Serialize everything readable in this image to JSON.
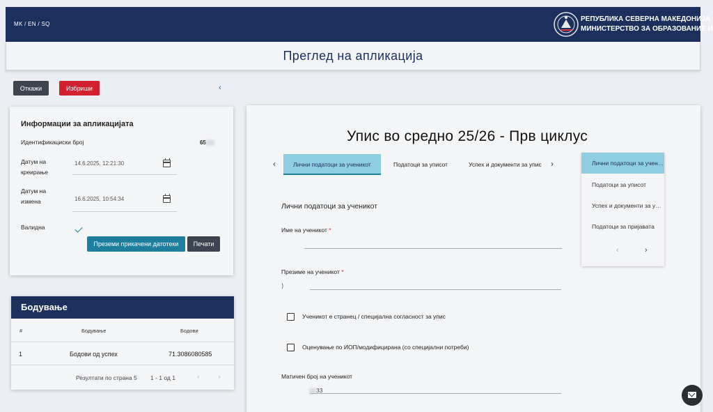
{
  "header": {
    "languages": "MK / EN / SQ",
    "republic": "РЕПУБЛИКА СЕВЕРНА МАКЕДОНИЈА",
    "ministry": "МИНИСТЕРСТВО ЗА ОБРАЗОВАНИЕ И НАУКА",
    "emblem_icon": "coat-of-arms-icon"
  },
  "page": {
    "title": "Преглед на апликација"
  },
  "actions": {
    "cancel": "Откажи",
    "delete": "Избриши",
    "collapse_icon": "chevron-left-icon"
  },
  "info": {
    "title": "Информации за апликацијата",
    "id_label": "Идентификациски број",
    "id_value": "65",
    "created_label": "Датум на креирање",
    "created_value": "14.6.2025, 12:21:30",
    "modified_label": "Датум на измена",
    "modified_value": "16.6.2025, 10:54:34",
    "valid_label": "Валидна",
    "download": "Преземи прикачени датотеки",
    "print": "Печати"
  },
  "scoring": {
    "title": "Бодување",
    "columns": [
      "#",
      "Бодување",
      "Бодови"
    ],
    "rows": [
      {
        "num": "1",
        "name": "Бодови од успех",
        "points": "71.3086080585"
      }
    ],
    "per_page_label": "Резултати по страна",
    "per_page": "5",
    "range": "1 - 1 од 1"
  },
  "form": {
    "title": "Упис во средно 25/26 - Прв циклус",
    "tabs": [
      "Лични податоци за ученикот",
      "Податоци за уписот",
      "Успех и документи за упис"
    ],
    "section": "Лични податоци за ученикот",
    "first_name_label": "Име на ученикот",
    "last_name_label": "Презиме на ученикот",
    "required_mark": "*",
    "foreigner_label": "Ученикот е странец / специјална согласност за упис",
    "iop_label": "Оценување по ИОП/модифицирана (со специјални потреби)",
    "embg_label": "Матичен број на ученикот",
    "embg_value": "33"
  },
  "stepper": {
    "items": [
      "Лични податоци за ученикот",
      "Податоци за уписот",
      "Успех и документи за упис",
      "Податоци за пријавата"
    ]
  },
  "colors": {
    "navy": "#1c2f5d",
    "teal": "#1d7e9e",
    "red": "#d3202f",
    "active_tab": "#8fcde0"
  }
}
